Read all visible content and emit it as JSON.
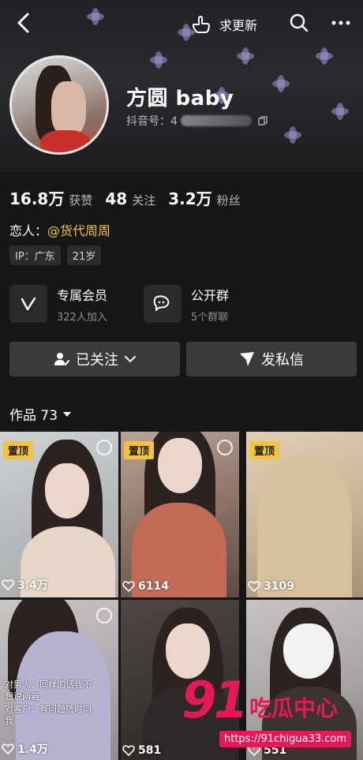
{
  "topbar": {
    "back_icon": "chevron-left-icon",
    "update_label": "求更新",
    "update_icon": "hand-point-icon",
    "search_icon": "search-icon",
    "more_icon": "more-dots-icon"
  },
  "profile": {
    "nickname": "方圆 baby",
    "id_label": "抖音号：4",
    "id_icon": "copy-icon"
  },
  "stats": [
    {
      "value": "16.8万",
      "label": "获赞"
    },
    {
      "value": "48",
      "label": "关注"
    },
    {
      "value": "3.2万",
      "label": "粉丝"
    }
  ],
  "lover": {
    "label": "恋人：",
    "link": "@货代周周"
  },
  "tags": [
    "IP：广东",
    "21岁"
  ],
  "features": [
    {
      "title": "专属会员",
      "sub": "322人加入",
      "icon": "v-badge-icon"
    },
    {
      "title": "公开群",
      "sub": "5个群聊",
      "icon": "chat-bubbles-icon"
    }
  ],
  "actions": {
    "followed_label": "已关注",
    "message_label": "发私信"
  },
  "works": {
    "label": "作品 73"
  },
  "videos": [
    {
      "pinned": "置顶",
      "likes": "3.4万"
    },
    {
      "pinned": "置顶",
      "likes": "6114"
    },
    {
      "pinned": "置顶",
      "likes": "3109"
    },
    {
      "likes": "1.4万",
      "caption": "对男人：同样的话我不\n想说两遍\n对客户：有问题随时问\n我"
    },
    {
      "likes": "581"
    },
    {
      "likes": "551"
    }
  ],
  "watermark": {
    "brand_num": "91",
    "brand_text": "吃瓜中心",
    "url": "https://91chigua33.com"
  },
  "colors": {
    "accent": "#f3c33b",
    "background": "#161616",
    "button": "#3a3a3c",
    "watermark": "#e5185a"
  }
}
